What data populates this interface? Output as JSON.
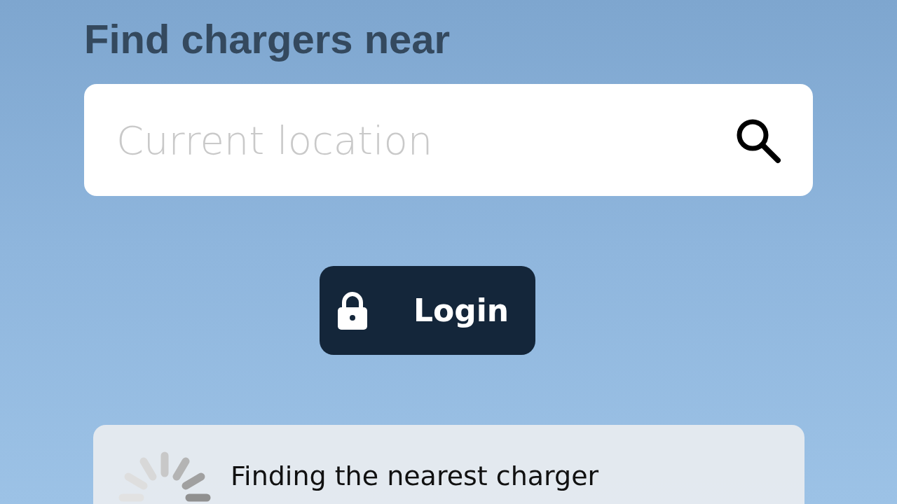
{
  "heading": "Find chargers near",
  "search": {
    "placeholder": "Current location"
  },
  "login_button": {
    "label": "Login"
  },
  "status_card": {
    "message": "Finding the nearest charger"
  }
}
